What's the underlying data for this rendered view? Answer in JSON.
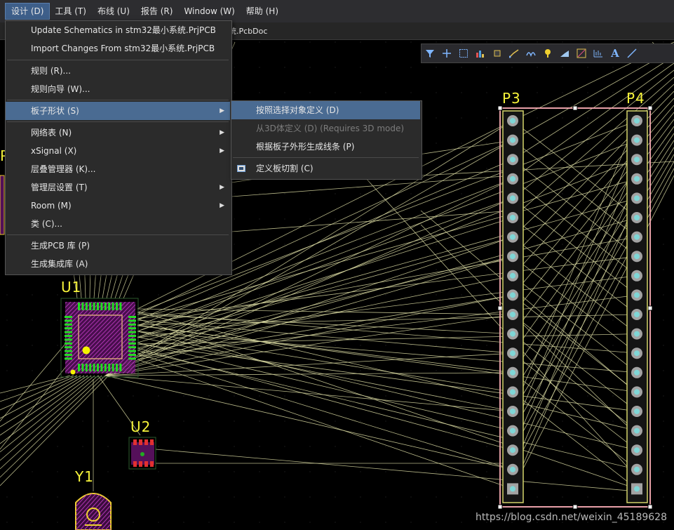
{
  "menubar": {
    "items": [
      {
        "label": "设计 (D)",
        "active": true
      },
      {
        "label": "工具 (T)",
        "active": false
      },
      {
        "label": "布线 (U)",
        "active": false
      },
      {
        "label": "报告 (R)",
        "active": false
      },
      {
        "label": "Window (W)",
        "active": false
      },
      {
        "label": "帮助 (H)",
        "active": false
      }
    ]
  },
  "document_tab": {
    "label": "统.PcbDoc"
  },
  "toolbar": {
    "icons": [
      "filter-icon",
      "crosshair-icon",
      "select-rect-icon",
      "chart-icon",
      "component-icon",
      "route-icon",
      "arc-route-icon",
      "pad-icon",
      "fill-icon",
      "line-icon",
      "dimension-icon",
      "text-icon",
      "draw-line-icon"
    ]
  },
  "design_menu": {
    "items": [
      {
        "label": "Update Schematics in stm32最小系统.PrjPCB",
        "submenu": false
      },
      {
        "label": "Import Changes From stm32最小系统.PrjPCB",
        "submenu": false
      },
      {
        "label": "规则 (R)...",
        "submenu": false
      },
      {
        "label": "规则向导 (W)...",
        "submenu": false
      },
      {
        "label": "板子形状 (S)",
        "submenu": true,
        "highlighted": true
      },
      {
        "label": "网络表 (N)",
        "submenu": true
      },
      {
        "label": "xSignal (X)",
        "submenu": true
      },
      {
        "label": "层叠管理器 (K)...",
        "submenu": false
      },
      {
        "label": "管理层设置 (T)",
        "submenu": true
      },
      {
        "label": "Room (M)",
        "submenu": true
      },
      {
        "label": "类 (C)...",
        "submenu": false
      },
      {
        "label": "生成PCB 库 (P)",
        "submenu": false
      },
      {
        "label": "生成集成库 (A)",
        "submenu": false
      }
    ]
  },
  "board_shape_submenu": {
    "items": [
      {
        "label": "按照选择对象定义 (D)",
        "highlighted": true,
        "disabled": false
      },
      {
        "label": "从3D体定义 (D) (Requires 3D mode)",
        "highlighted": false,
        "disabled": true
      },
      {
        "label": "根据板子外形生成线条 (P)",
        "highlighted": false,
        "disabled": false
      },
      {
        "label": "定义板切割 (C)",
        "highlighted": false,
        "disabled": false
      }
    ]
  },
  "pcb": {
    "designators": {
      "p3": "P3",
      "p4": "P4",
      "u1": "U1",
      "u2": "U2",
      "y1": "Y1",
      "partial": "P"
    },
    "colors": {
      "ratsnest": "#d8d8a0",
      "designator": "#f7f43a",
      "pad": "#a3a3a3",
      "board_edge": "#e8a0a8",
      "component_pad": "#22dd22",
      "overlay": "#c63fc6"
    }
  },
  "watermark": "https://blog.csdn.net/weixin_45189628"
}
